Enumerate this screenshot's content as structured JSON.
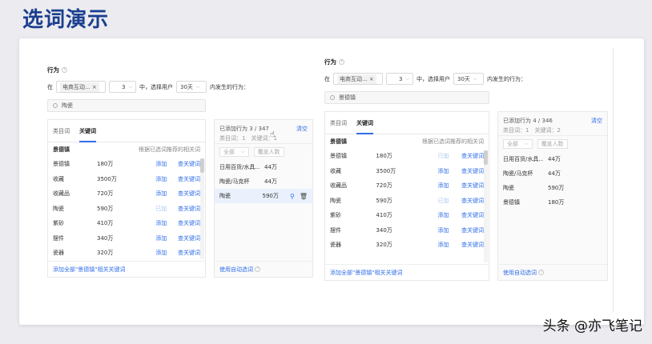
{
  "page_title": "选词演示",
  "watermark": "头条 @亦飞笔记",
  "panels": [
    {
      "behavior_label": "行为",
      "in_label": "在",
      "channel_tag": "电商互动...",
      "close_symbol": "×",
      "count_value": "3",
      "mid_text": "中，选择用户",
      "days_value": "30天",
      "behavior_text": "内发生的行为：",
      "search_value": "陶瓷",
      "tabs": [
        "类目词",
        "关键词"
      ],
      "active_tab": "关键词",
      "table_head": "景德镇",
      "table_note": "根据已选词推荐的相关词",
      "rows": [
        {
          "word": "景德镇",
          "count": "180万",
          "action": "添加",
          "action_disabled": false,
          "link": "查关键词"
        },
        {
          "word": "收藏",
          "count": "3500万",
          "action": "添加",
          "action_disabled": false,
          "link": "查关键词"
        },
        {
          "word": "收藏品",
          "count": "720万",
          "action": "添加",
          "action_disabled": false,
          "link": "查关键词"
        },
        {
          "word": "陶瓷",
          "count": "590万",
          "action": "已加",
          "action_disabled": true,
          "link": "查关键词"
        },
        {
          "word": "紫砂",
          "count": "410万",
          "action": "添加",
          "action_disabled": false,
          "link": "查关键词"
        },
        {
          "word": "摆件",
          "count": "340万",
          "action": "添加",
          "action_disabled": false,
          "link": "查关键词"
        },
        {
          "word": "瓷器",
          "count": "320万",
          "action": "添加",
          "action_disabled": false,
          "link": "查关键词"
        }
      ],
      "footer_link": "添加全部\"景德镇\"相关关键词",
      "added_label": "已添加行为 3 / 347",
      "clear_label": "清空",
      "added_sub": "类目词：1　关键词：1",
      "filter_all": "全部",
      "filter_sort": "覆盖人数",
      "added": [
        {
          "name": "日用百货/水具...",
          "value": "44万"
        },
        {
          "name": "陶瓷/马克杯",
          "value": "44万"
        },
        {
          "name": "陶瓷",
          "value": "590万"
        }
      ],
      "auto_link": "使用自动选词"
    },
    {
      "behavior_label": "行为",
      "in_label": "在",
      "channel_tag": "电商互动...",
      "close_symbol": "×",
      "count_value": "3",
      "mid_text": "中，选择用户",
      "days_value": "30天",
      "behavior_text": "内发生的行为：",
      "search_value": "景德镇",
      "tabs": [
        "类目词",
        "关键词"
      ],
      "active_tab": "关键词",
      "table_head": "景德镇",
      "table_note": "根据已选词推荐的相关词",
      "rows": [
        {
          "word": "景德镇",
          "count": "180万",
          "action": "已加",
          "action_disabled": true,
          "link": "查关键词"
        },
        {
          "word": "收藏",
          "count": "3500万",
          "action": "添加",
          "action_disabled": false,
          "link": "查关键词"
        },
        {
          "word": "收藏品",
          "count": "720万",
          "action": "添加",
          "action_disabled": false,
          "link": "查关键词"
        },
        {
          "word": "陶瓷",
          "count": "590万",
          "action": "已加",
          "action_disabled": true,
          "link": "查关键词"
        },
        {
          "word": "紫砂",
          "count": "410万",
          "action": "添加",
          "action_disabled": false,
          "link": "查关键词"
        },
        {
          "word": "摆件",
          "count": "340万",
          "action": "添加",
          "action_disabled": false,
          "link": "查关键词"
        },
        {
          "word": "瓷器",
          "count": "320万",
          "action": "添加",
          "action_disabled": false,
          "link": "查关键词"
        }
      ],
      "footer_link": "添加全部\"景德镇\"相关关键词",
      "added_label": "已添加行为 4 / 346",
      "clear_label": "清空",
      "added_sub": "类目词：1　关键词：2",
      "filter_all": "全部",
      "filter_sort": "覆盖人数",
      "added": [
        {
          "name": "日用百货/水具...",
          "value": "44万"
        },
        {
          "name": "陶瓷/马克杯",
          "value": "44万"
        },
        {
          "name": "陶瓷",
          "value": "590万"
        },
        {
          "name": "景德镇",
          "value": "180万"
        }
      ],
      "auto_link": "使用自动选词"
    }
  ],
  "colors": {
    "accent": "#2f6ee8",
    "title": "#1b3f8f"
  }
}
